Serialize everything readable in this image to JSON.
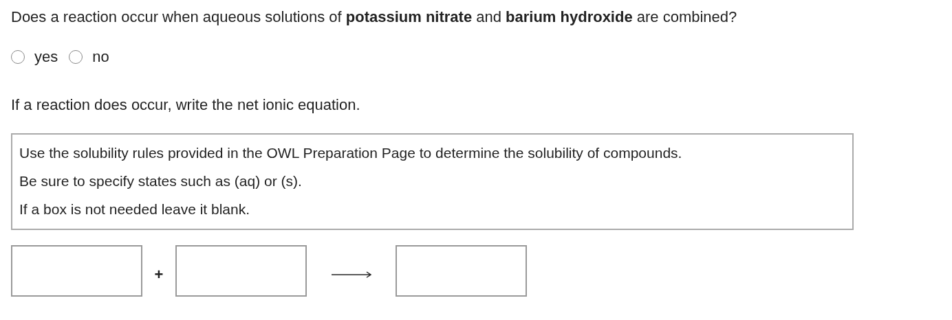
{
  "question": "Does a reaction occur when aqueous solutions of **potassium nitrate** and **barium hydroxide** are combined?",
  "options": [
    {
      "label": "yes",
      "selected": false
    },
    {
      "label": "no",
      "selected": false
    }
  ],
  "instruction": "If a reaction does occur, write the net ionic equation.",
  "notes": [
    "Use the solubility rules provided in the OWL Preparation Page to determine the solubility of compounds.",
    "Be sure to specify states such as (aq) or (s).",
    "If a box is not needed leave it blank."
  ],
  "equation": [
    {
      "kind": "box"
    },
    {
      "kind": "operator",
      "text": "+"
    },
    {
      "kind": "box"
    },
    {
      "kind": "arrow"
    },
    {
      "kind": "box"
    }
  ]
}
